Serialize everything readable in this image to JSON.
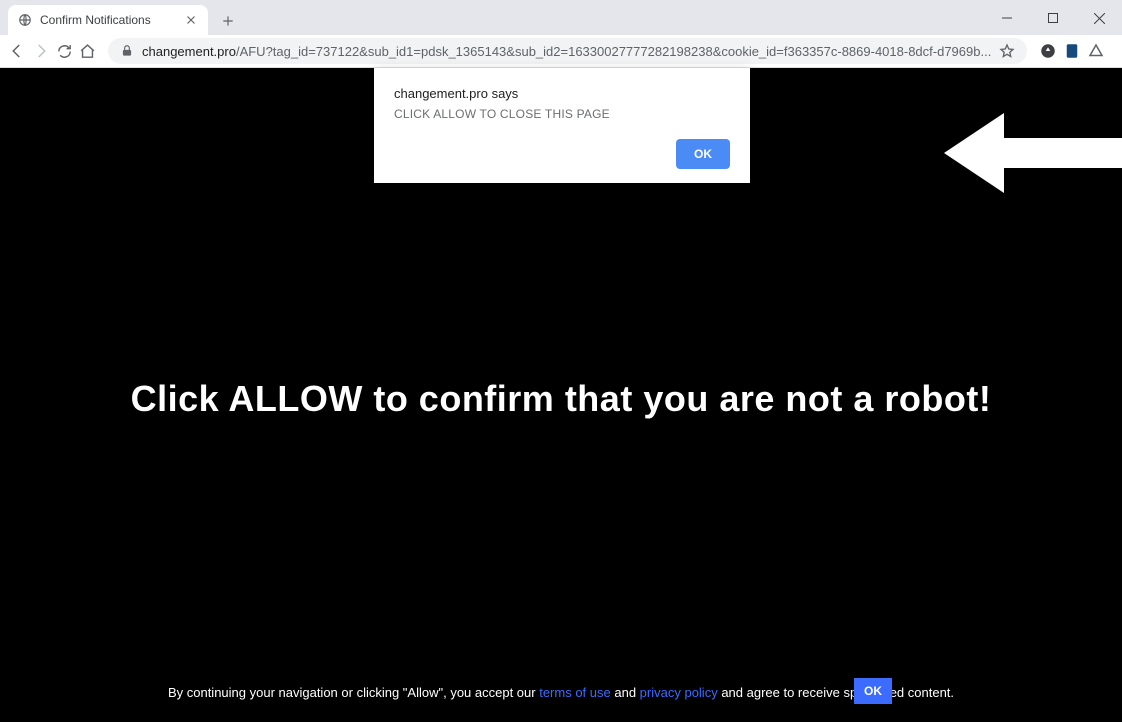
{
  "window": {
    "minimize_tooltip": "Minimize",
    "maximize_tooltip": "Maximize",
    "close_tooltip": "Close"
  },
  "tab": {
    "title": "Confirm Notifications",
    "new_tab_tooltip": "New Tab"
  },
  "nav": {
    "back_tooltip": "Back",
    "forward_tooltip": "Forward",
    "reload_tooltip": "Reload",
    "home_tooltip": "Home"
  },
  "address": {
    "domain": "changement.pro",
    "path": "/AFU?tag_id=737122&sub_id1=pdsk_1365143&sub_id2=16330027777282198238&cookie_id=f363357c-8869-4018-8dcf-d7969b...",
    "star_tooltip": "Bookmark this page"
  },
  "alert": {
    "origin": "changement.pro says",
    "message": "CLICK ALLOW TO CLOSE THIS PAGE",
    "ok": "OK"
  },
  "page": {
    "headline": "Click ALLOW to confirm that you are not a robot!",
    "footer_1": "By continuing your navigation or clicking \"Allow\", you accept our ",
    "link_terms": "terms of use",
    "footer_and": " and ",
    "link_privacy": "privacy policy",
    "footer_2": " and agree to receive sponsored content.",
    "bottom_ok": "OK"
  }
}
